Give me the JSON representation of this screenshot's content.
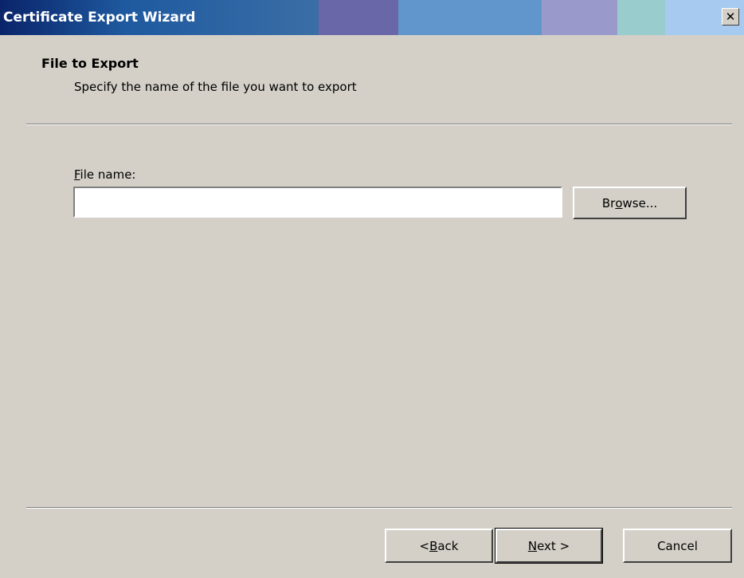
{
  "window": {
    "title": "Certificate Export Wizard",
    "close_glyph": "✕",
    "titlebar_colors": [
      "#0a246a",
      "#1f5aa0",
      "#3a6ea5",
      "#6a67a8",
      "#5e91c8",
      "#6f9fd4",
      "#9999cc",
      "#99cccc",
      "#a6caf0"
    ]
  },
  "header": {
    "title": "File to Export",
    "subtitle": "Specify the name of the file you want to export"
  },
  "form": {
    "file_label_accel": "F",
    "file_label_rest": "ile name:",
    "file_value": "",
    "browse_accel_pre": "Br",
    "browse_accel": "o",
    "browse_rest": "wse..."
  },
  "footer": {
    "back_pre": "< ",
    "back_accel": "B",
    "back_rest": "ack",
    "next_accel": "N",
    "next_rest": "ext >",
    "cancel_label": "Cancel"
  },
  "icons": {
    "close": "close-icon"
  }
}
